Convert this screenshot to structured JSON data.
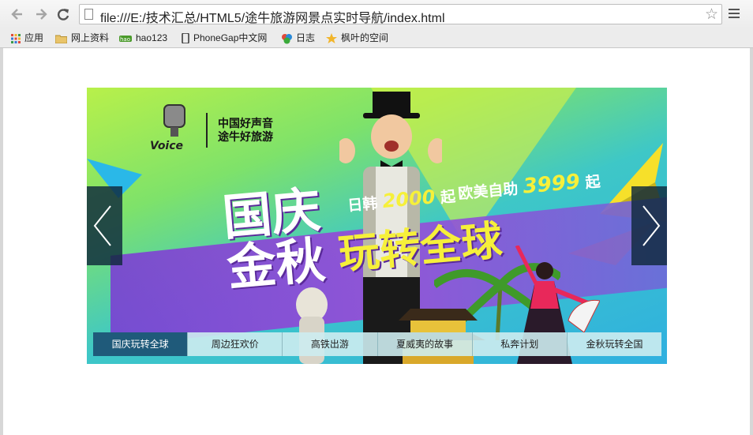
{
  "browser": {
    "url": "file:///E:/技术汇总/HTML5/途牛旅游网景点实时导航/index.html",
    "bookmarks": [
      {
        "label": "应用",
        "icon": "apps-grid-icon"
      },
      {
        "label": "网上资料",
        "icon": "folder-icon"
      },
      {
        "label": "hao123",
        "icon": "hao123-icon"
      },
      {
        "label": "PhoneGap中文网",
        "icon": "phonegap-icon"
      },
      {
        "label": "日志",
        "icon": "blog-icon"
      },
      {
        "label": "枫叶的空间",
        "icon": "star-space-icon"
      }
    ]
  },
  "banner": {
    "logo_caption_1": "中国好声音",
    "logo_caption_2": "途牛好旅游",
    "headline_line1": "国庆",
    "headline_line2": "金秋",
    "slogan": "玩转全球",
    "promo_japan_label": "日韩",
    "promo_japan_price": "2000",
    "promo_japan_suffix": "起",
    "promo_europe_label": "欧美自助",
    "promo_europe_price": "3999",
    "promo_europe_suffix": "起",
    "prev_arrow": "‹",
    "next_arrow": "›",
    "tabs": [
      {
        "label": "国庆玩转全球",
        "active": true
      },
      {
        "label": "周边狂欢价",
        "active": false
      },
      {
        "label": "高铁出游",
        "active": false
      },
      {
        "label": "夏威夷的故事",
        "active": false
      },
      {
        "label": "私奔计划",
        "active": false
      },
      {
        "label": "金秋玩转全国",
        "active": false
      }
    ]
  },
  "colors": {
    "active_tab": "#1f5a7a",
    "accent_yellow": "#f6f03a",
    "purple_band": "#7b3fd3"
  }
}
